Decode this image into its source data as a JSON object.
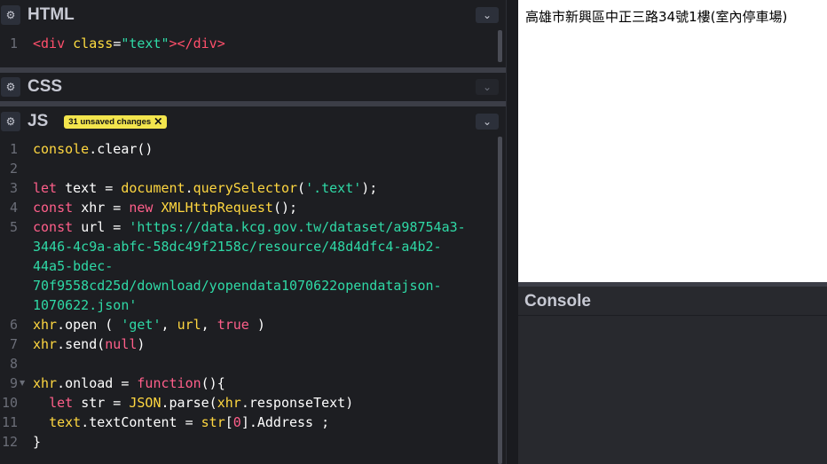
{
  "html_panel": {
    "title": "HTML",
    "lines": [
      {
        "num": "1",
        "parts": [
          [
            "tag",
            "<div "
          ],
          [
            "attr",
            "class"
          ],
          [
            "white",
            "="
          ],
          [
            "str",
            "\"text\""
          ],
          [
            "tag",
            "></div>"
          ]
        ]
      }
    ]
  },
  "css_panel": {
    "title": "CSS"
  },
  "js_panel": {
    "title": "JS",
    "badge": "31 unsaved changes",
    "badge_close": "✕",
    "line_numbers": [
      "1",
      "2",
      "3",
      "4",
      "5",
      "6",
      "7",
      "8",
      "9",
      "10",
      "11",
      "12"
    ],
    "fold_marker": "▼",
    "lines": [
      [
        [
          "fn",
          "console"
        ],
        [
          "white",
          ".clear()"
        ]
      ],
      [],
      [
        [
          "kw",
          "let "
        ],
        [
          "white",
          "text = "
        ],
        [
          "fn",
          "document"
        ],
        [
          "white",
          "."
        ],
        [
          "fn",
          "querySelector"
        ],
        [
          "white",
          "("
        ],
        [
          "str",
          "'.text'"
        ],
        [
          "white",
          ");"
        ]
      ],
      [
        [
          "kw",
          "const "
        ],
        [
          "white",
          "xhr = "
        ],
        [
          "kw",
          "new "
        ],
        [
          "fn",
          "XMLHttpRequest"
        ],
        [
          "white",
          "();"
        ]
      ],
      [
        [
          "kw",
          "const "
        ],
        [
          "white",
          "url = "
        ],
        [
          "str",
          "'https://data.kcg.gov.tw/dataset/a98754a3-"
        ]
      ],
      [
        [
          "str",
          "3446-4c9a-abfc-58dc49f2158c/resource/48d4dfc4-a4b2-"
        ]
      ],
      [
        [
          "str",
          "44a5-bdec-"
        ]
      ],
      [
        [
          "str",
          "70f9558cd25d/download/yopendata1070622opendatajson-"
        ]
      ],
      [
        [
          "str",
          "1070622.json'"
        ]
      ],
      [
        [
          "fn",
          "xhr"
        ],
        [
          "white",
          ".open ( "
        ],
        [
          "str",
          "'get'"
        ],
        [
          "white",
          ", "
        ],
        [
          "fn",
          "url"
        ],
        [
          "white",
          ", "
        ],
        [
          "kw",
          "true"
        ],
        [
          "white",
          " )"
        ]
      ],
      [
        [
          "fn",
          "xhr"
        ],
        [
          "white",
          ".send("
        ],
        [
          "kw",
          "null"
        ],
        [
          "white",
          ")"
        ]
      ],
      [],
      [
        [
          "fn",
          "xhr"
        ],
        [
          "white",
          ".onload = "
        ],
        [
          "kw",
          "function"
        ],
        [
          "white",
          "(){"
        ]
      ],
      [
        [
          "white",
          "  "
        ],
        [
          "kw",
          "let "
        ],
        [
          "white",
          "str = "
        ],
        [
          "fn",
          "JSON"
        ],
        [
          "white",
          ".parse("
        ],
        [
          "fn",
          "xhr"
        ],
        [
          "white",
          ".responseText)"
        ]
      ],
      [
        [
          "white",
          "  "
        ],
        [
          "fn",
          "text"
        ],
        [
          "white",
          ".textContent = "
        ],
        [
          "fn",
          "str"
        ],
        [
          "white",
          "["
        ],
        [
          "num",
          "0"
        ],
        [
          "white",
          "].Address ;"
        ]
      ],
      [
        [
          "white",
          "}"
        ]
      ]
    ]
  },
  "preview": {
    "text": "高雄市新興區中正三路34號1樓(室內停車場)"
  },
  "console": {
    "title": "Console"
  },
  "icons": {
    "gear": "gear-icon",
    "collapse": "chevron-down-icon"
  }
}
